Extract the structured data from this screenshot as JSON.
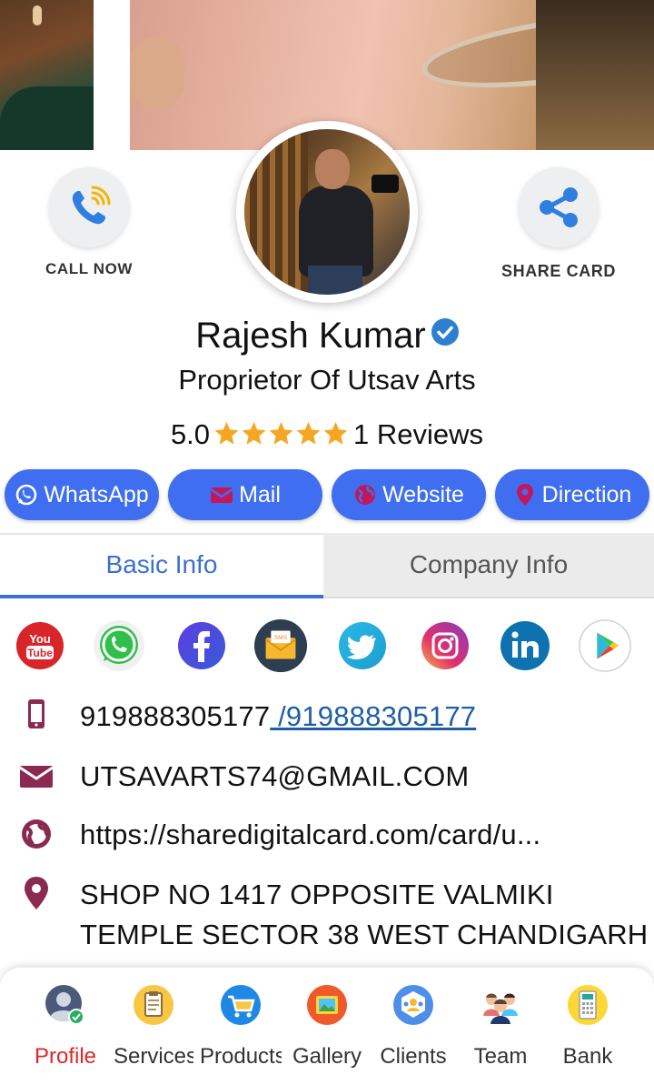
{
  "actions": {
    "call_now": "CALL NOW",
    "share_card": "SHARE CARD"
  },
  "profile": {
    "name": "Rajesh Kumar",
    "subtitle": "Proprietor Of Utsav Arts",
    "rating": "5.0",
    "rating_stars": 5,
    "reviews": "1 Reviews"
  },
  "pills": {
    "whatsapp": "WhatsApp",
    "mail": "Mail",
    "website": "Website",
    "direction": "Direction"
  },
  "tabs": {
    "basic": "Basic Info",
    "company": "Company Info",
    "active": "basic"
  },
  "social_icons": [
    "youtube-icon",
    "whatsapp-icon",
    "facebook-icon",
    "sms-icon",
    "twitter-icon",
    "instagram-icon",
    "linkedin-icon",
    "play-store-icon"
  ],
  "contact": {
    "phone": "919888305177",
    "phone_link": " /919888305177",
    "email": "UTSAVARTS74@GMAIL.COM",
    "website": "https://sharedigitalcard.com/card/u...",
    "address": "SHOP NO 1417 OPPOSITE VALMIKI TEMPLE SECTOR 38 WEST CHANDIGARH"
  },
  "nav": {
    "profile": "Profile",
    "services": "Services",
    "products": "Products",
    "gallery": "Gallery",
    "clients": "Clients",
    "team": "Team",
    "bank": "Bank"
  },
  "colors": {
    "accent_blue": "#3f6ff0",
    "tab_active": "#3b6fd1",
    "icon_maroon": "#8a2a52",
    "nav_active": "#e0262b",
    "star": "#f5a623"
  }
}
